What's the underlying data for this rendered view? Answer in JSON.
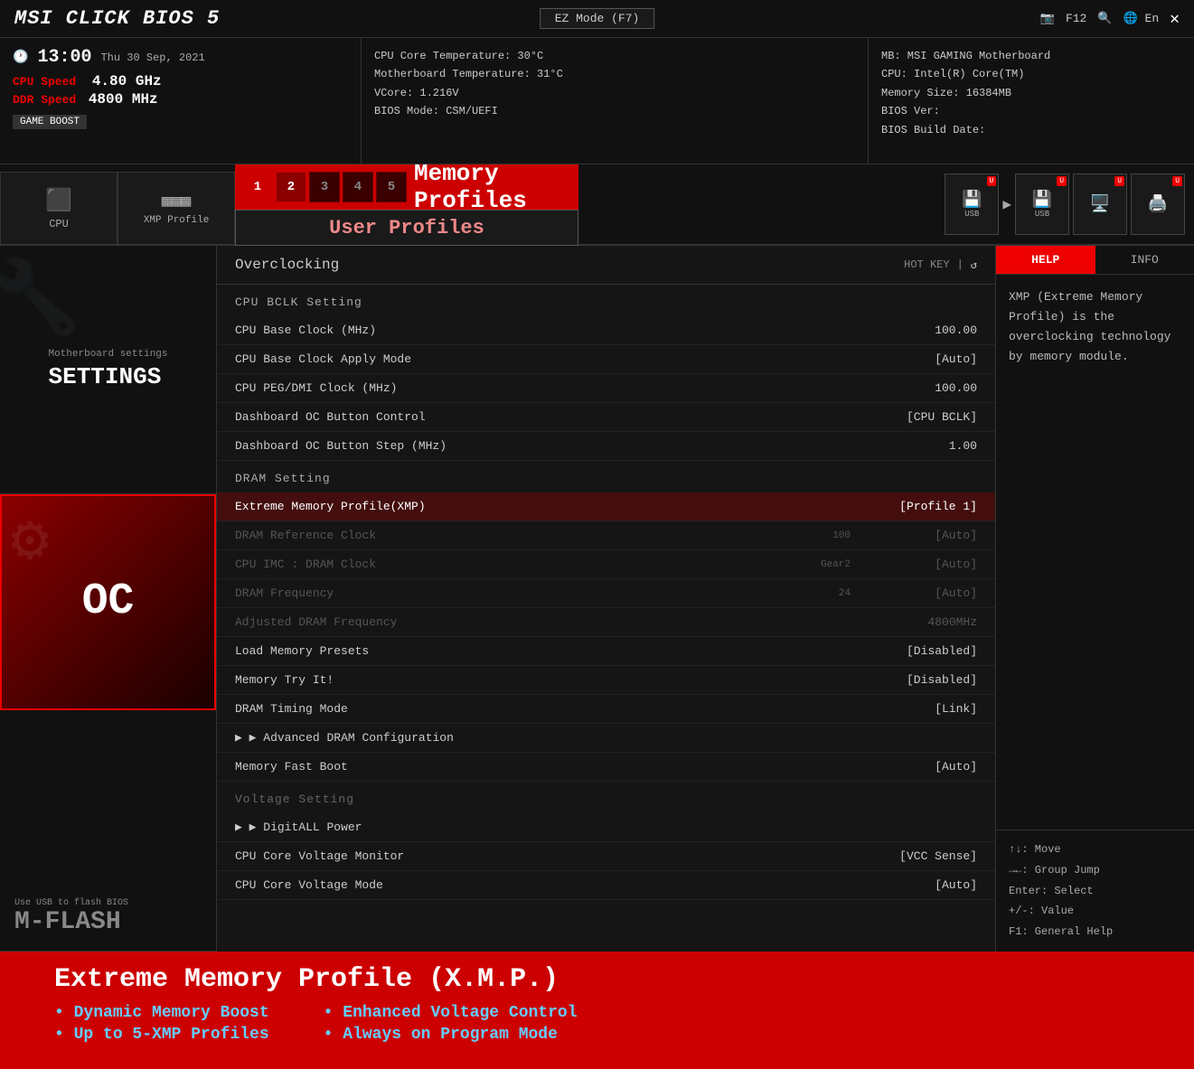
{
  "header": {
    "logo": "MSI CLICK BIOS 5",
    "center": "EZ Mode (F7)",
    "f12": "F12",
    "lang": "En",
    "close": "✕"
  },
  "infobar": {
    "time": "13:00",
    "date": "Thu 30 Sep, 2021",
    "cpu_speed_label": "CPU Speed",
    "cpu_speed_value": "4.80 GHz",
    "ddr_speed_label": "DDR Speed",
    "ddr_speed_value": "4800 MHz",
    "game_boost": "GAME BOOST",
    "cpu_temp": "CPU Core Temperature: 30°C",
    "mb_temp": "Motherboard Temperature: 31°C",
    "vcore": "VCore: 1.216V",
    "bios_mode": "BIOS Mode: CSM/UEFI",
    "mb": "MB: MSI GAMING Motherboard",
    "cpu": "CPU: Intel(R) Core(TM)",
    "memory_size": "Memory Size: 16384MB",
    "bios_ver": "BIOS Ver:",
    "bios_build": "BIOS Build Date:"
  },
  "tabs": {
    "cpu_label": "CPU",
    "xmp_label": "XMP Profile",
    "memory_profiles": "Memory Profiles",
    "user_profiles": "User Profiles",
    "xmp_buttons": [
      "1",
      "2"
    ],
    "usb_label": "USB"
  },
  "overclocking": {
    "title": "Overclocking",
    "hotkey": "HOT KEY",
    "sections": {
      "cpu_bclk": "CPU BCLK Setting",
      "dram": "DRAM Setting",
      "voltage": "Voltage Setting"
    },
    "settings": [
      {
        "name": "CPU Base Clock (MHz)",
        "value": "100.00",
        "dimmed": false,
        "highlighted": false
      },
      {
        "name": "CPU Base Clock Apply Mode",
        "value": "[Auto]",
        "dimmed": false,
        "highlighted": false
      },
      {
        "name": "CPU PEG/DMI Clock (MHz)",
        "value": "100.00",
        "dimmed": false,
        "highlighted": false
      },
      {
        "name": "Dashboard OC Button Control",
        "value": "[CPU BCLK]",
        "dimmed": false,
        "highlighted": false
      },
      {
        "name": "Dashboard OC Button Step (MHz)",
        "value": "1.00",
        "dimmed": false,
        "highlighted": false
      },
      {
        "name": "Extreme Memory Profile(XMP)",
        "value": "[Profile 1]",
        "dimmed": false,
        "highlighted": true
      },
      {
        "name": "DRAM Reference Clock",
        "sub": "100",
        "value": "[Auto]",
        "dimmed": true,
        "highlighted": false
      },
      {
        "name": "CPU IMC : DRAM Clock",
        "sub": "Gear2",
        "value": "[Auto]",
        "dimmed": true,
        "highlighted": false
      },
      {
        "name": "DRAM Frequency",
        "sub": "24",
        "value": "[Auto]",
        "dimmed": true,
        "highlighted": false
      },
      {
        "name": "Adjusted DRAM Frequency",
        "value": "4800MHz",
        "dimmed": true,
        "highlighted": false
      },
      {
        "name": "Load Memory Presets",
        "value": "[Disabled]",
        "dimmed": false,
        "highlighted": false
      },
      {
        "name": "Memory Try It!",
        "value": "[Disabled]",
        "dimmed": false,
        "highlighted": false
      },
      {
        "name": "DRAM Timing Mode",
        "value": "[Link]",
        "dimmed": false,
        "highlighted": false
      },
      {
        "name": "Advanced DRAM Configuration",
        "value": "",
        "dimmed": false,
        "highlighted": false,
        "arrow": true
      },
      {
        "name": "Memory Fast Boot",
        "value": "[Auto]",
        "dimmed": false,
        "highlighted": false
      },
      {
        "name": "DigitALL Power",
        "value": "",
        "dimmed": false,
        "highlighted": false,
        "arrow": true
      },
      {
        "name": "CPU Core Voltage Monitor",
        "value": "[VCC Sense]",
        "dimmed": false,
        "highlighted": false
      },
      {
        "name": "CPU Core Voltage Mode",
        "value": "[Auto]",
        "dimmed": false,
        "highlighted": false
      }
    ]
  },
  "help": {
    "tab_help": "HELP",
    "tab_info": "INFO",
    "content": "XMP (Extreme Memory Profile) is the overclocking technology by memory module.",
    "keys": [
      "↑↓: Move",
      "→←: Group Jump",
      "Enter: Select",
      "+/-: Value",
      "F1: General Help"
    ]
  },
  "sidebar": {
    "settings_sub": "Motherboard settings",
    "settings_label": "SETTINGS",
    "oc_label": "OC",
    "mflash_sub": "Use USB to flash BIOS",
    "mflash_label": "M-FLASH"
  },
  "bottom": {
    "title": "Extreme Memory Profile (X.M.P.)",
    "features_left": [
      "Dynamic Memory Boost",
      "Up to 5-XMP Profiles"
    ],
    "features_right": [
      "Enhanced Voltage Control",
      "Always on Program Mode"
    ]
  }
}
